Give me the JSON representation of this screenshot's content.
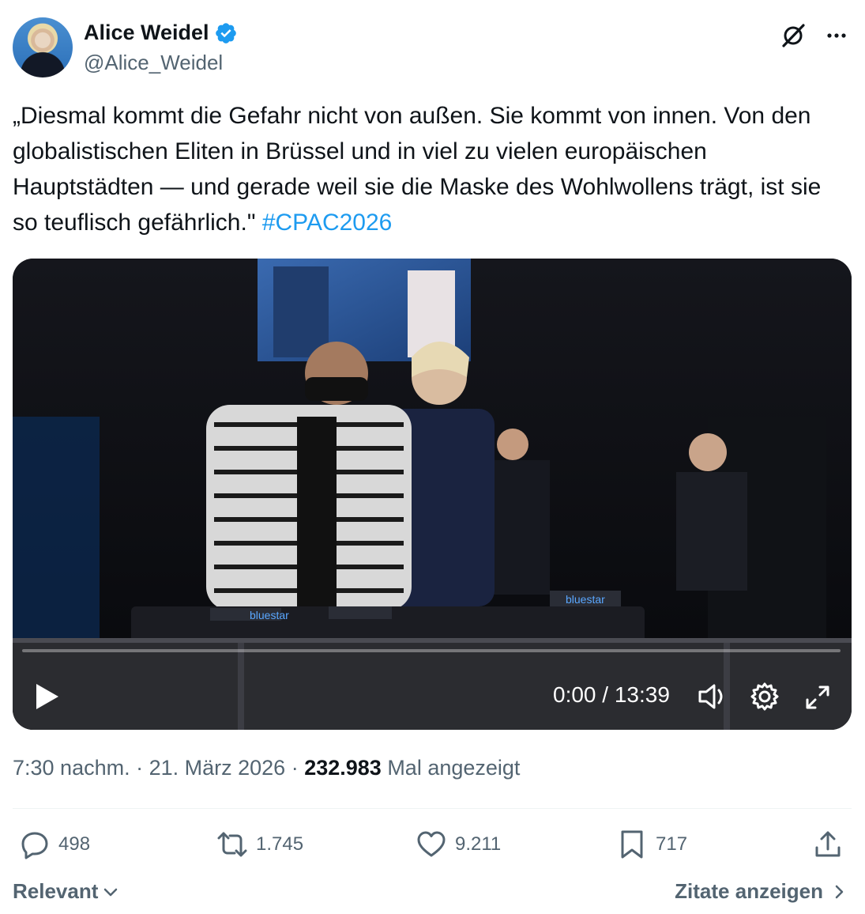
{
  "author": {
    "name": "Alice Weidel",
    "handle": "@Alice_Weidel"
  },
  "tweet": {
    "text": "„Diesmal kommt die Gefahr nicht von außen. Sie kommt von innen. Von den globalistischen Eliten in Brüssel und in viel zu vielen europäischen Hauptstädten — und gerade weil sie die Maske des Wohlwollens trägt, ist sie so teuflisch gefährlich.\" ",
    "hashtag": "#CPAC2026"
  },
  "video": {
    "time": "0:00 / 13:39",
    "progress": 0,
    "overlay_text": "bluestar"
  },
  "meta": {
    "time": "7:30 nachm.",
    "sep": " · ",
    "date": "21. März 2026",
    "views": "232.983",
    "views_label": " Mal angezeigt"
  },
  "actions": {
    "replies": "498",
    "reposts": "1.745",
    "likes": "9.211",
    "bookmarks": "717"
  },
  "footer": {
    "sort_label": "Relevant",
    "quotes_label": "Zitate anzeigen"
  },
  "colors": {
    "accent": "#1d9bf0",
    "text": "#0f1419",
    "muted": "#536471"
  }
}
